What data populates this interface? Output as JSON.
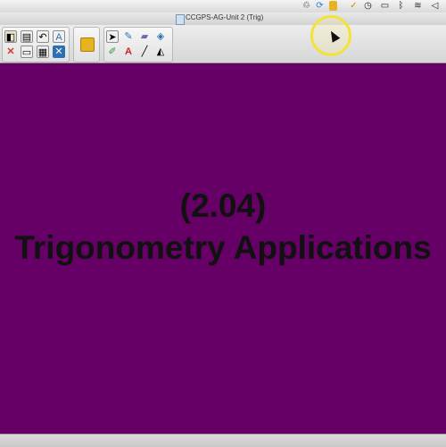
{
  "window": {
    "title": "CCGPS-AG-Unit 2 (Trig)"
  },
  "menubar": {
    "icons": [
      "recycle-icon",
      "sync-icon",
      "clip-icon",
      "check-icon",
      "time-machine-icon",
      "display-icon",
      "bluetooth-icon",
      "wifi-icon",
      "volume-icon"
    ]
  },
  "toolbar": {
    "groups": [
      {
        "name": "file-group",
        "buttons": [
          "new-page",
          "page-sorter",
          "undo",
          "text-recognize",
          "delete",
          "screen-shade",
          "table",
          "close"
        ]
      },
      {
        "name": "clip-group",
        "buttons": [
          "clip"
        ]
      },
      {
        "name": "tools-group",
        "buttons": [
          "select",
          "pen",
          "eraser",
          "fill",
          "creative-pen",
          "text",
          "line",
          "shape"
        ]
      }
    ],
    "colors": {
      "delete": "#d33a2c",
      "accent_blue": "#2b6fb5"
    }
  },
  "slide": {
    "background": "#660066",
    "number": "(2.04)",
    "title": "Trigonometry Applications"
  },
  "cursor": {
    "highlight_color": "#f2e23a"
  }
}
